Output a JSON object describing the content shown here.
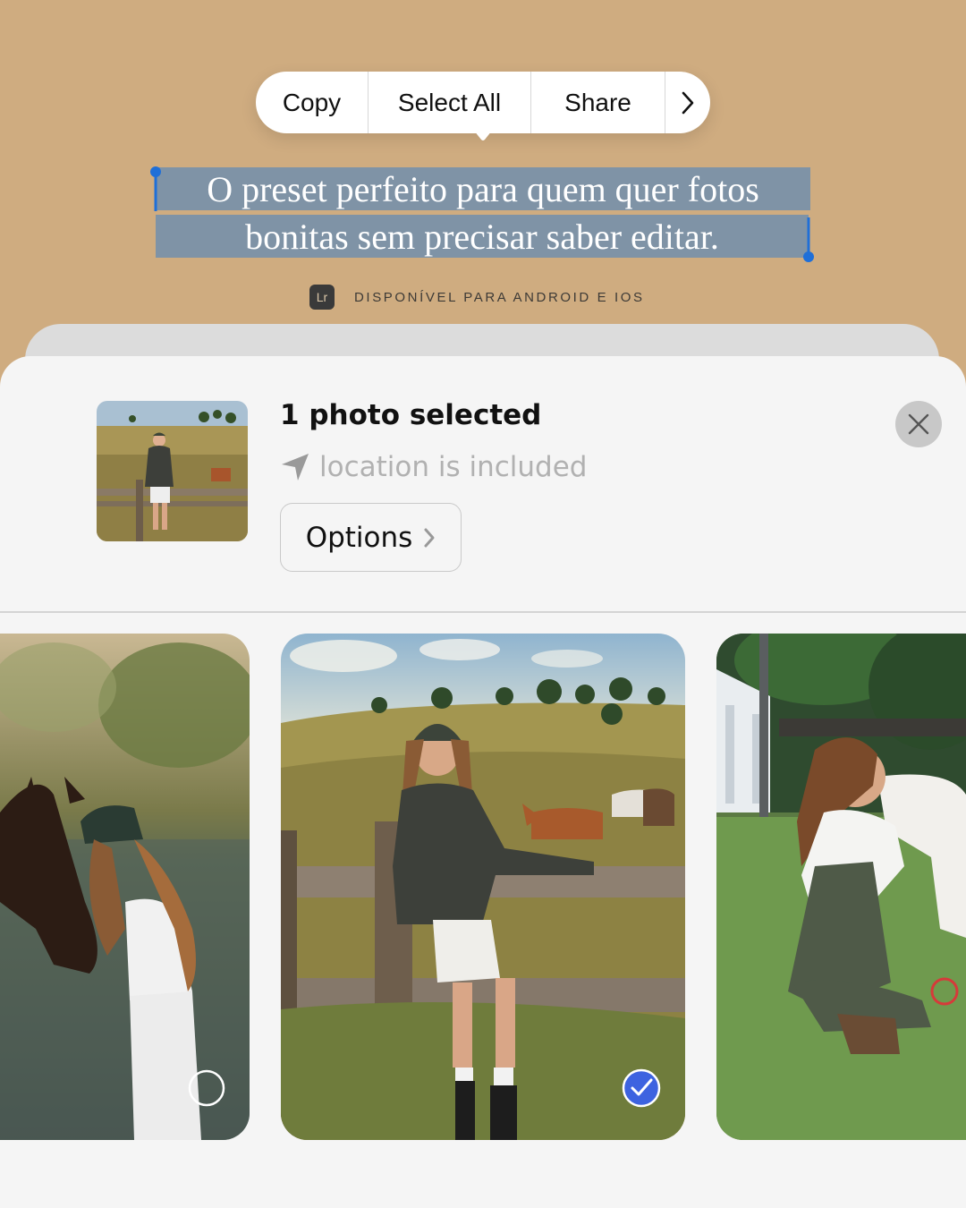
{
  "context_menu": {
    "items": [
      "Copy",
      "Select All",
      "Share"
    ],
    "more_icon": "chevron-right-icon"
  },
  "headline": {
    "line1": "O preset perfeito para quem quer fotos",
    "line2": "bonitas sem precisar saber editar.",
    "selection_color": "#7f93a6"
  },
  "availability": {
    "badge": "Lr",
    "text": "DISPONÍVEL PARA ANDROID E IOS"
  },
  "share_sheet": {
    "title": "1 photo selected",
    "location_text": "location is included",
    "location_icon": "location-arrow-icon",
    "options_label": "Options",
    "close_icon": "close-icon"
  },
  "photos": [
    {
      "name": "woman-with-horse-by-water",
      "selected": false
    },
    {
      "name": "woman-at-fence-with-horses",
      "selected": true
    },
    {
      "name": "woman-with-white-horse",
      "selected": false
    }
  ],
  "colors": {
    "background": "#cfac80",
    "sheet": "#f5f5f5",
    "check_blue": "#3d63e0",
    "handle_blue": "#1f6fd8"
  }
}
